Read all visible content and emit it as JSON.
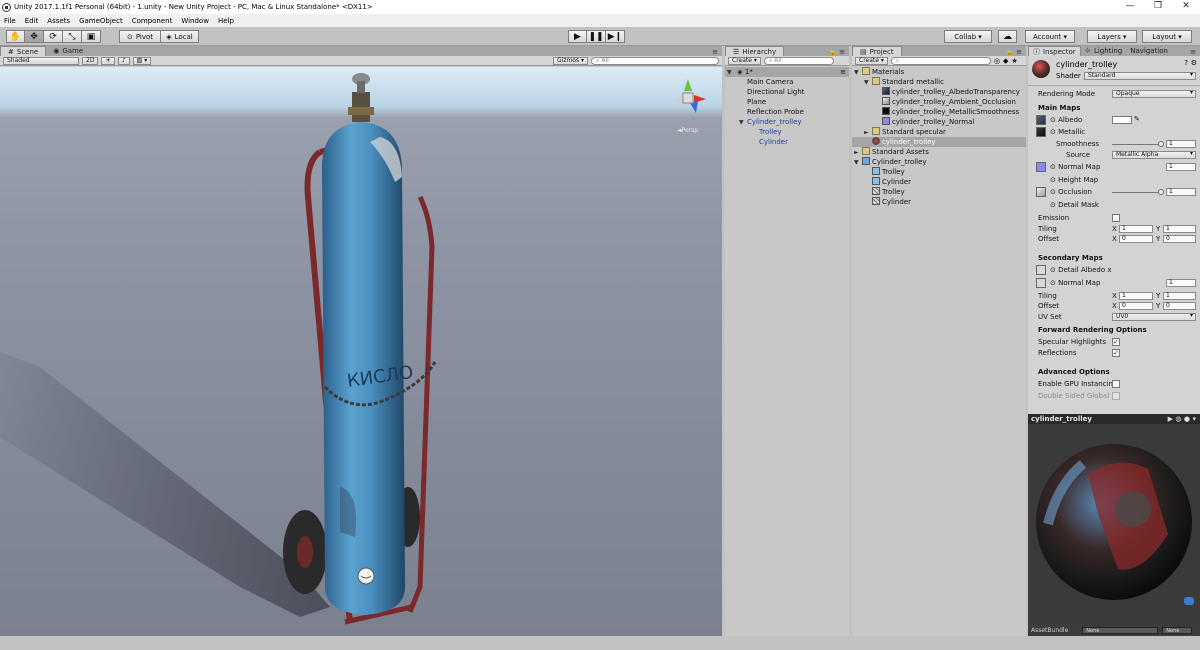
{
  "window": {
    "title": "Unity 2017.1.1f1 Personal (64bit) - 1.unity - New Unity Project - PC, Mac & Linux Standalone* <DX11>",
    "controls": [
      "—",
      "❐",
      "✕"
    ]
  },
  "menu": [
    "File",
    "Edit",
    "Assets",
    "GameObject",
    "Component",
    "Window",
    "Help"
  ],
  "toolbar": {
    "pivot": "Pivot",
    "local": "Local",
    "collab": "Collab ▾",
    "account": "Account ▾",
    "layers": "Layers ▾",
    "layout": "Layout ▾"
  },
  "scene": {
    "tab_scene": "Scene",
    "tab_game": "Game",
    "shading": "Shaded",
    "mode_2d": "2D",
    "gizmos": "Gizmos ▾",
    "search_placeholder": "All",
    "persp_label": "◄Persp",
    "tank_text": "КИСЛО"
  },
  "hierarchy": {
    "tab": "Hierarchy",
    "create": "Create ▾",
    "search_placeholder": "All",
    "scene_name": "1*",
    "items": [
      {
        "label": "Main Camera",
        "indent": 1,
        "style": "normal"
      },
      {
        "label": "Directional Light",
        "indent": 1,
        "style": "normal"
      },
      {
        "label": "Plane",
        "indent": 1,
        "style": "normal"
      },
      {
        "label": "Reflection Probe",
        "indent": 1,
        "style": "normal"
      },
      {
        "label": "Cylinder_trolley",
        "indent": 1,
        "style": "blue",
        "arrow": "▼"
      },
      {
        "label": "Trolley",
        "indent": 2,
        "style": "blue"
      },
      {
        "label": "Cylinder",
        "indent": 2,
        "style": "blue"
      }
    ]
  },
  "project": {
    "tab": "Project",
    "create": "Create ▾",
    "items": [
      {
        "label": "Materials",
        "indent": 0,
        "arrow": "▼",
        "icon": "folder"
      },
      {
        "label": "Standard metallic",
        "indent": 1,
        "arrow": "▼",
        "icon": "folder"
      },
      {
        "label": "cylinder_trolley_AlbedoTransparency",
        "indent": 2,
        "icon": "tex-dark"
      },
      {
        "label": "cylinder_trolley_Ambient_Occlusion",
        "indent": 2,
        "icon": "tex-light"
      },
      {
        "label": "cylinder_trolley_MetallicSmoothness",
        "indent": 2,
        "icon": "tex-black"
      },
      {
        "label": "cylinder_trolley_Normal",
        "indent": 2,
        "icon": "tex-normal"
      },
      {
        "label": "Standard specular",
        "indent": 1,
        "arrow": "►",
        "icon": "folder"
      },
      {
        "label": "cylinder_trolley",
        "indent": 1,
        "icon": "material",
        "selected": true
      },
      {
        "label": "Standard Assets",
        "indent": 0,
        "arrow": "►",
        "icon": "folder"
      },
      {
        "label": "Cylinder_trolley",
        "indent": 0,
        "arrow": "▼",
        "icon": "prefab"
      },
      {
        "label": "Trolley",
        "indent": 1,
        "icon": "mesh-object"
      },
      {
        "label": "Cylinder",
        "indent": 1,
        "icon": "mesh-object"
      },
      {
        "label": "Trolley",
        "indent": 1,
        "icon": "mesh"
      },
      {
        "label": "Cylinder",
        "indent": 1,
        "icon": "mesh"
      }
    ]
  },
  "inspector": {
    "tab_inspector": "Inspector",
    "tab_lighting": "Lighting",
    "tab_navigation": "Navigation",
    "material_name": "cylinder_trolley",
    "shader_label": "Shader",
    "shader_value": "Standard",
    "rendering_mode_label": "Rendering Mode",
    "rendering_mode_value": "Opaque",
    "main_maps": "Main Maps",
    "albedo": "Albedo",
    "metallic": "Metallic",
    "smoothness": "Smoothness",
    "smoothness_value": "1",
    "source_label": "Source",
    "source_value": "Metallic Alpha",
    "normal_map": "Normal Map",
    "normal_value": "1",
    "height_map": "Height Map",
    "occlusion": "Occlusion",
    "occlusion_value": "1",
    "detail_mask": "Detail Mask",
    "emission": "Emission",
    "tiling": "Tiling",
    "offset": "Offset",
    "x": "X",
    "y": "Y",
    "tiling_x": "1",
    "tiling_y": "1",
    "offset_x": "0",
    "offset_y": "0",
    "secondary_maps": "Secondary Maps",
    "detail_albedo": "Detail Albedo x",
    "normal_map2": "Normal Map",
    "normal_value2": "1",
    "tiling2_x": "1",
    "tiling2_y": "1",
    "offset2_x": "0",
    "offset2_y": "0",
    "uv_set_label": "UV Set",
    "uv_set_value": "UV0",
    "forward_rendering": "Forward Rendering Options",
    "specular_highlights": "Specular Highlights",
    "reflections": "Reflections",
    "advanced": "Advanced Options",
    "gpu_instancing": "Enable GPU Instancin",
    "double_sided": "Double Sided Global",
    "preview_title": "cylinder_trolley",
    "assetbundle_label": "AssetBundle",
    "assetbundle_value": "None",
    "assetbundle_variant": "None"
  }
}
